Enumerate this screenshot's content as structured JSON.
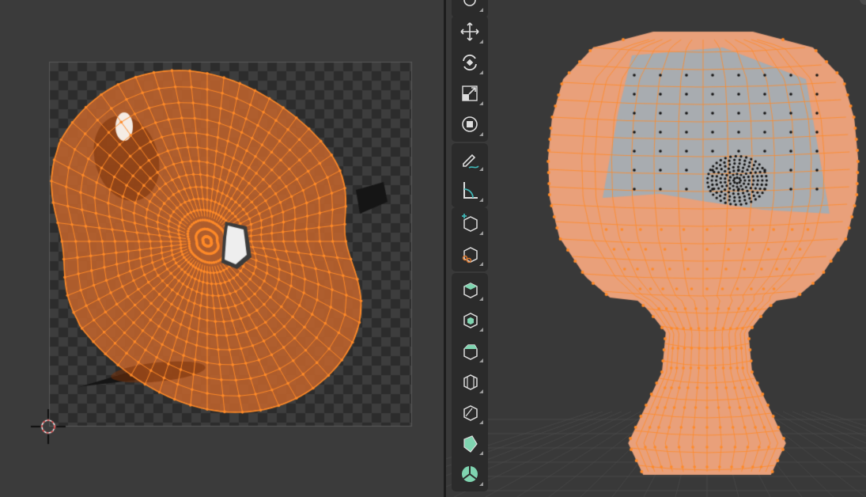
{
  "uv_editor": {
    "image_background": "#2f2f2f",
    "checker_light": "#3d3d3d",
    "checker_dark": "#2c2c2c",
    "uv_face_color": "#b9612d",
    "uv_edge_color": "#ff8a28",
    "uv_vertex_color": "#ff8a28",
    "cursor_icon": "2d-cursor-icon"
  },
  "viewport": {
    "background": "#393939",
    "mesh_selected_face": "#e9a07a",
    "mesh_unselected_face": "#a8acb0",
    "edge_selected": "#ff8a28",
    "vertex_unselected": "#111111"
  },
  "toolbar": {
    "groups": [
      {
        "tools": [
          {
            "name": "select-box",
            "label": "Select Box",
            "icon": "select-icon"
          }
        ]
      },
      {
        "tools": [
          {
            "name": "move",
            "label": "Move",
            "icon": "move-icon"
          },
          {
            "name": "rotate",
            "label": "Rotate",
            "icon": "rotate-icon"
          },
          {
            "name": "scale",
            "label": "Scale",
            "icon": "scale-icon"
          },
          {
            "name": "transform",
            "label": "Transform",
            "icon": "transform-icon"
          }
        ]
      },
      {
        "tools": [
          {
            "name": "annotate",
            "label": "Annotate",
            "icon": "annotate-icon"
          },
          {
            "name": "measure",
            "label": "Measure",
            "icon": "measure-icon"
          }
        ]
      },
      {
        "tools": [
          {
            "name": "add-cube",
            "label": "Add Cube",
            "icon": "add-cube-icon"
          },
          {
            "name": "knife-cut",
            "label": "Knife Cut",
            "icon": "knife-icon"
          }
        ]
      },
      {
        "tools": [
          {
            "name": "extrude-region",
            "label": "Extrude Region",
            "icon": "extrude-icon"
          },
          {
            "name": "inset-faces",
            "label": "Inset Faces",
            "icon": "inset-icon"
          },
          {
            "name": "bevel",
            "label": "Bevel",
            "icon": "bevel-icon"
          },
          {
            "name": "loop-cut",
            "label": "Loop Cut",
            "icon": "loop-cut-icon"
          },
          {
            "name": "knife",
            "label": "Knife",
            "icon": "knife-tool-icon"
          },
          {
            "name": "poly-build",
            "label": "Poly Build",
            "icon": "poly-build-icon"
          },
          {
            "name": "spin",
            "label": "Spin",
            "icon": "spin-icon"
          }
        ]
      }
    ]
  }
}
